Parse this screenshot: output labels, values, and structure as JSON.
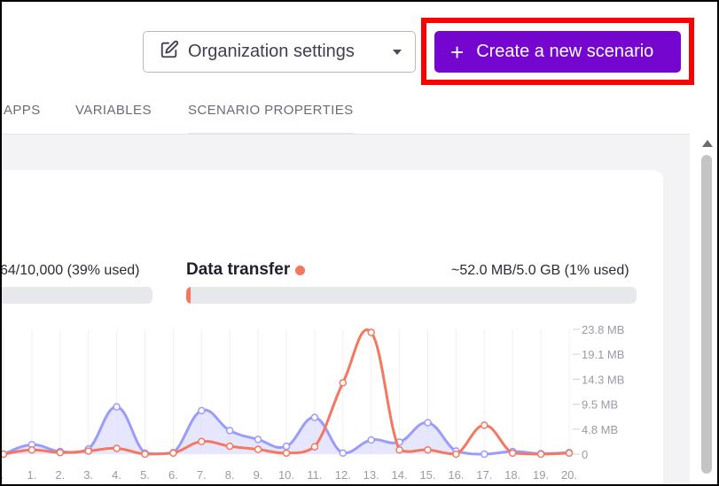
{
  "header": {
    "org_settings_label": "Organization settings",
    "create_label": "Create a new scenario",
    "icons": {
      "org": "pencil-square-icon",
      "caret": "caret-down-icon",
      "create": "plus-icon"
    },
    "accent_color": "#7406cf",
    "highlight_color": "#ff0000"
  },
  "tabs": [
    {
      "label": "APPS"
    },
    {
      "label": "VARIABLES"
    },
    {
      "label": "SCENARIO PROPERTIES"
    }
  ],
  "usage": {
    "operations_text": "64/10,000 (39% used)",
    "operations_fraction": 0.39,
    "data_transfer_title": "Data transfer",
    "data_transfer_text": "~52.0 MB/5.0 GB (1% used)",
    "data_transfer_fraction": 0.01,
    "data_transfer_color": "#f4775f"
  },
  "chart_data": {
    "type": "line",
    "x": [
      "1.",
      "1.",
      "2.",
      "3.",
      "4.",
      "5.",
      "6.",
      "7.",
      "8.",
      "9.",
      "10.",
      "11.",
      "12.",
      "13.",
      "14.",
      "15.",
      "16.",
      "17.",
      "18.",
      "19.",
      "20."
    ],
    "y_tick_labels": [
      "23.8 MB",
      "19.1 MB",
      "14.3 MB",
      "9.5 MB",
      "4.8 MB",
      "0"
    ],
    "ylim": [
      0,
      23.8
    ],
    "series": [
      {
        "color": "#9b9bff",
        "fill": "#dcdcff",
        "values": [
          0.0,
          1.8,
          0.5,
          1.0,
          9.0,
          0.2,
          0.3,
          8.3,
          4.5,
          2.8,
          1.5,
          7.0,
          0.2,
          2.7,
          2.3,
          6.0,
          0.6,
          0.0,
          0.5,
          0.1,
          0.3
        ]
      },
      {
        "color": "#f4775f",
        "values": [
          0.0,
          0.8,
          0.3,
          0.6,
          1.1,
          0.0,
          0.2,
          2.4,
          1.5,
          0.9,
          0.2,
          1.4,
          13.6,
          23.2,
          0.8,
          0.8,
          0.0,
          5.5,
          0.2,
          0.0,
          0.2
        ]
      }
    ],
    "grid": true
  }
}
